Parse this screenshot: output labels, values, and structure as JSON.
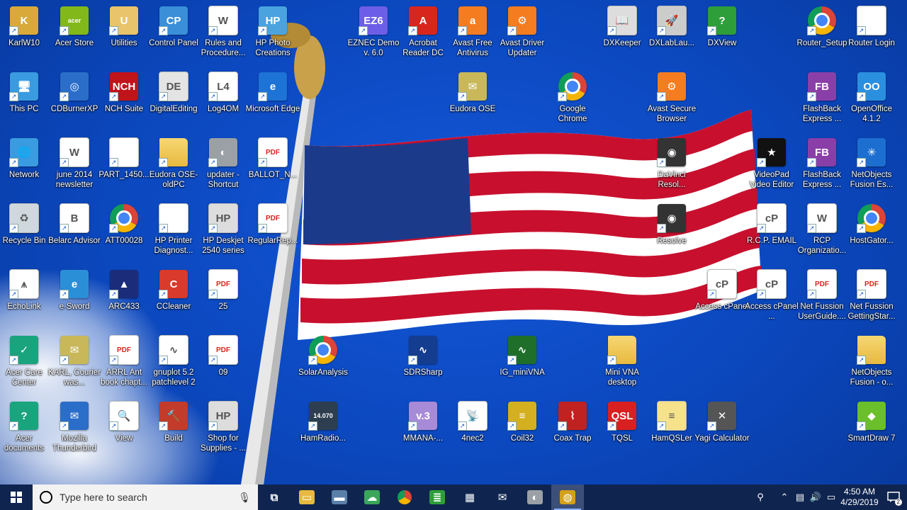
{
  "desktop_icons": [
    {
      "label": "KarlW10",
      "glyph": "K",
      "color": "#d9a93a"
    },
    {
      "label": "Acer Store",
      "glyph": "acer",
      "color": "#83b81a"
    },
    {
      "label": "Utilities",
      "glyph": "U",
      "color": "#e9c46a"
    },
    {
      "label": "Control Panel",
      "glyph": "CP",
      "color": "#3a8fd8"
    },
    {
      "label": "Rules and Procedure...",
      "glyph": "W",
      "color": "#ffffff"
    },
    {
      "label": "HP Photo Creations",
      "glyph": "HP",
      "color": "#4aa3df"
    },
    {
      "label": "EZNEC Demo v. 6.0",
      "glyph": "EZ6",
      "color": "#6d5ee8"
    },
    {
      "label": "Acrobat Reader DC",
      "glyph": "A",
      "color": "#d9261c"
    },
    {
      "label": "Avast Free Antivirus",
      "glyph": "a",
      "color": "#f57c1f"
    },
    {
      "label": "Avast Driver Updater",
      "glyph": "⚙",
      "color": "#f57c1f"
    },
    {
      "label": "DXKeeper",
      "glyph": "📖",
      "color": "#dddddd"
    },
    {
      "label": "DXLabLau...",
      "glyph": "🚀",
      "color": "#cccccc"
    },
    {
      "label": "DXView",
      "glyph": "?",
      "color": "#2e9e3a"
    },
    {
      "label": "Router_Setup",
      "glyph": "",
      "color": "chrome"
    },
    {
      "label": "Router Login",
      "glyph": "",
      "color": "#ffffff"
    },
    {
      "label": "This PC",
      "glyph": "🖥",
      "color": "#3a9be0"
    },
    {
      "label": "CDBurnerXP",
      "glyph": "◎",
      "color": "#2b6ec9"
    },
    {
      "label": "NCH Suite",
      "glyph": "NCH",
      "color": "#c0141b"
    },
    {
      "label": "DigitalEditing",
      "glyph": "DE",
      "color": "#e4e4e4"
    },
    {
      "label": "Log4OM",
      "glyph": "L4",
      "color": "#ffffff"
    },
    {
      "label": "Microsoft Edge",
      "glyph": "e",
      "color": "#1e73d6"
    },
    {
      "label": "Eudora OSE",
      "glyph": "✉",
      "color": "#c9b85a"
    },
    {
      "label": "Google Chrome",
      "glyph": "",
      "color": "chrome"
    },
    {
      "label": "Avast Secure Browser",
      "glyph": "⚙",
      "color": "#f57c1f"
    },
    {
      "label": "FlashBack Express ...",
      "glyph": "FB",
      "color": "#8a3fa8"
    },
    {
      "label": "OpenOffice 4.1.2",
      "glyph": "OO",
      "color": "#2b8fe0"
    },
    {
      "label": "Network",
      "glyph": "🌐",
      "color": "#3a9be0"
    },
    {
      "label": "june 2014 newsletter",
      "glyph": "W",
      "color": "#ffffff"
    },
    {
      "label": "PART_1450...",
      "glyph": "",
      "color": "#ffffff"
    },
    {
      "label": "Eudora OSE-oldPC",
      "glyph": "",
      "color": "folder"
    },
    {
      "label": "updater - Shortcut",
      "glyph": "◐",
      "color": "#9aa0a6"
    },
    {
      "label": "BALLOT_N...",
      "glyph": "PDF",
      "color": "pdf"
    },
    {
      "label": "DaVinci Resol...",
      "glyph": "◉",
      "color": "#333333"
    },
    {
      "label": "VideoPad Video Editor",
      "glyph": "★",
      "color": "#111111"
    },
    {
      "label": "FlashBack Express ...",
      "glyph": "FB",
      "color": "#8a3fa8"
    },
    {
      "label": "NetObjects Fusion Es...",
      "glyph": "✳",
      "color": "#1c6fd0"
    },
    {
      "label": "Recycle Bin",
      "glyph": "♻",
      "color": "#cfd8dc"
    },
    {
      "label": "Belarc Advisor",
      "glyph": "B",
      "color": "#ffffff"
    },
    {
      "label": "ATT00028",
      "glyph": "",
      "color": "chrome"
    },
    {
      "label": "HP Printer Diagnost...",
      "glyph": "",
      "color": "#ffffff"
    },
    {
      "label": "HP Deskjet 2540 series",
      "glyph": "HP",
      "color": "#dddddd"
    },
    {
      "label": "RegularRep...",
      "glyph": "PDF",
      "color": "pdf"
    },
    {
      "label": "Resolve",
      "glyph": "◉",
      "color": "#333333"
    },
    {
      "label": "R.C.P. EMAIL",
      "glyph": "cP",
      "color": "#ffffff"
    },
    {
      "label": "RCP Organizatio...",
      "glyph": "W",
      "color": "#ffffff"
    },
    {
      "label": "HostGator...",
      "glyph": "",
      "color": "chrome"
    },
    {
      "label": "EchoLink",
      "glyph": "⩚",
      "color": "#ffffff"
    },
    {
      "label": "e-Sword",
      "glyph": "e",
      "color": "#2b8fd8"
    },
    {
      "label": "ARC433",
      "glyph": "▲",
      "color": "#1a2c7a"
    },
    {
      "label": "CCleaner",
      "glyph": "C",
      "color": "#d93a2b"
    },
    {
      "label": "25",
      "glyph": "PDF",
      "color": "pdf"
    },
    {
      "label": "Access cPanel",
      "glyph": "cP",
      "color": "#ffffff"
    },
    {
      "label": "Access cPanel ...",
      "glyph": "cP",
      "color": "#ffffff"
    },
    {
      "label": "Net Fussion UserGuide....",
      "glyph": "PDF",
      "color": "pdf"
    },
    {
      "label": "Net Fussion GettingStar...",
      "glyph": "PDF",
      "color": "pdf"
    },
    {
      "label": "Acer Care Center",
      "glyph": "✓",
      "color": "#19a47e"
    },
    {
      "label": "KARL, Courier was...",
      "glyph": "✉",
      "color": "#c9b85a"
    },
    {
      "label": "ARRL Ant book chapt...",
      "glyph": "PDF",
      "color": "pdf"
    },
    {
      "label": "gnuplot 5.2 patchlevel 2",
      "glyph": "∿",
      "color": "#ffffff"
    },
    {
      "label": "09",
      "glyph": "PDF",
      "color": "pdf"
    },
    {
      "label": "SolarAnalysis",
      "glyph": "",
      "color": "chrome"
    },
    {
      "label": "SDRSharp",
      "glyph": "∿",
      "color": "#143c8f"
    },
    {
      "label": "IG_miniVNA",
      "glyph": "∿",
      "color": "#1f6f2a"
    },
    {
      "label": "Mini VNA desktop",
      "glyph": "",
      "color": "folder"
    },
    {
      "label": "NetObjects Fusion - o...",
      "glyph": "",
      "color": "folder"
    },
    {
      "label": "Acer documents",
      "glyph": "?",
      "color": "#19a47e"
    },
    {
      "label": "Mozilla Thunderbird",
      "glyph": "✉",
      "color": "#2b6ec9"
    },
    {
      "label": "View",
      "glyph": "🔍",
      "color": "#ffffff"
    },
    {
      "label": "Build",
      "glyph": "🔨",
      "color": "#c23b2b"
    },
    {
      "label": "Shop for Supplies - ...",
      "glyph": "HP",
      "color": "#dddddd"
    },
    {
      "label": "HamRadio...",
      "glyph": "14.070",
      "color": "#2c3e50"
    },
    {
      "label": "MMANA-...",
      "glyph": "v.3",
      "color": "#a78bd8"
    },
    {
      "label": "4nec2",
      "glyph": "📡",
      "color": "#ffffff"
    },
    {
      "label": "Coil32",
      "glyph": "≡",
      "color": "#d4b020"
    },
    {
      "label": "Coax Trap",
      "glyph": "⌇",
      "color": "#c02222"
    },
    {
      "label": "TQSL",
      "glyph": "QSL",
      "color": "#d82020"
    },
    {
      "label": "HamQSLer",
      "glyph": "≡",
      "color": "#f5e28a"
    },
    {
      "label": "Yagi Calculator",
      "glyph": "✕",
      "color": "#555555"
    },
    {
      "label": "SmartDraw 7",
      "glyph": "◆",
      "color": "#6abf2a"
    }
  ],
  "taskbar": {
    "search_placeholder": "Type here to search",
    "apps": [
      {
        "name": "task-view",
        "glyph": "⧉",
        "color": "#0f2550"
      },
      {
        "name": "file-explorer",
        "glyph": "▭",
        "color": "#e8b93e"
      },
      {
        "name": "app-blue",
        "glyph": "▬",
        "color": "#5a7fa8"
      },
      {
        "name": "app-green",
        "glyph": "☁",
        "color": "#3aa65a"
      },
      {
        "name": "chrome",
        "glyph": "",
        "color": "chrome"
      },
      {
        "name": "notepad-green",
        "glyph": "≣",
        "color": "#2e9e3a"
      },
      {
        "name": "calculator",
        "glyph": "▦",
        "color": "#0f2550"
      },
      {
        "name": "mail",
        "glyph": "✉",
        "color": "#0f2550"
      },
      {
        "name": "app-gray",
        "glyph": "◐",
        "color": "#9aa0a6"
      },
      {
        "name": "app-active",
        "glyph": "◍",
        "color": "#d4a11a"
      }
    ],
    "time": "4:50 AM",
    "date": "4/29/2019",
    "notification_count": "2"
  }
}
